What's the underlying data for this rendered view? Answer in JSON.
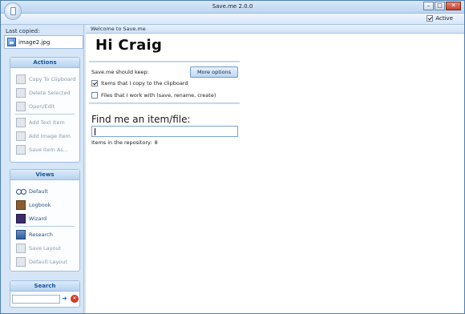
{
  "window": {
    "title": "Save.me 2.0.0",
    "min": "–",
    "max": "□",
    "close": "✕"
  },
  "ribbon": {
    "active_label": "Active",
    "active_checked": true
  },
  "left": {
    "last_copied_label": "Last copied:",
    "last_copied_file": "image2.jpg",
    "actions": {
      "header": "Actions",
      "items": [
        {
          "label": "Copy To Clipboard",
          "icon": "clipboard-icon"
        },
        {
          "label": "Delete Selected",
          "icon": "trash-icon"
        },
        {
          "label": "Open/Edit",
          "icon": "edit-icon"
        },
        {
          "label": "Add Text Item",
          "icon": "pencil-icon"
        },
        {
          "label": "Add Image Item",
          "icon": "image-icon"
        },
        {
          "label": "Save Item As...",
          "icon": "save-icon"
        }
      ]
    },
    "views": {
      "header": "Views",
      "items": [
        {
          "label": "Default",
          "icon": "glasses-icon"
        },
        {
          "label": "Logbook",
          "icon": "book-icon"
        },
        {
          "label": "Wizard",
          "icon": "wizard-icon"
        },
        {
          "label": "Research",
          "icon": "research-icon"
        },
        {
          "label": "Save Layout",
          "icon": "save-layout-icon"
        },
        {
          "label": "Default Layout",
          "icon": "default-layout-icon"
        }
      ]
    },
    "search": {
      "header": "Search",
      "go": "➜",
      "clear": "✕"
    }
  },
  "main": {
    "welcome_tab": "Welcome to Save.me",
    "greeting": "Hi Craig",
    "keep_label": "Save.me should keep:",
    "more_options": "More options",
    "options": [
      {
        "label": "Items that I copy to the clipboard",
        "checked": true
      },
      {
        "label": "Files that I work with (save, rename, create)",
        "checked": false
      }
    ],
    "find_label": "Find me an item/file:",
    "find_value": "",
    "count_label": "Items in the repository:",
    "count_value": "8"
  },
  "colors": {
    "accent": "#1a5596",
    "panel_bg": "#d6e6f7",
    "close_red": "#c0402b"
  }
}
